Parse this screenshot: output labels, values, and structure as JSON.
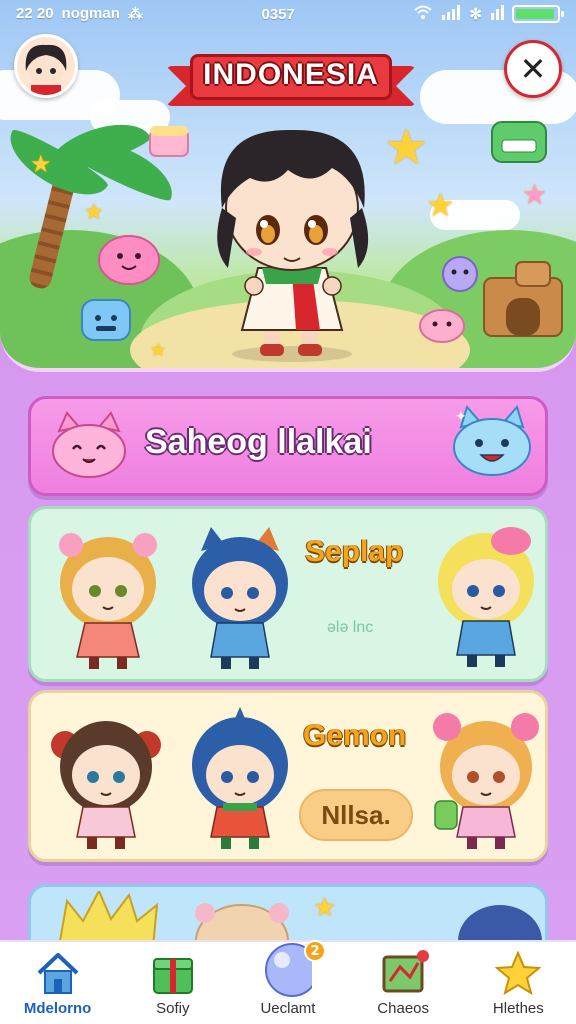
{
  "status_bar": {
    "time": "22 20",
    "carrier": "nogman",
    "center": "0357",
    "battery_fraction": 0.95
  },
  "hero": {
    "title": "INDONESIA",
    "avatar_icon": "player-avatar-icon",
    "close_label": "✕"
  },
  "cards": {
    "pink": {
      "title": "Saheog llalkai"
    },
    "mint": {
      "title": "Seplap",
      "subtitle": "ələ lnc"
    },
    "cream": {
      "title": "Gemon",
      "button_label": "Nllsa."
    }
  },
  "bottom_nav": {
    "items": [
      {
        "label": "Mdelorno",
        "icon": "home-icon",
        "active": true
      },
      {
        "label": "Sofiy",
        "icon": "gift-box-icon",
        "active": false
      },
      {
        "label": "Ueclamt",
        "icon": "orb-icon",
        "active": false,
        "badge": "2"
      },
      {
        "label": "Chaeos",
        "icon": "map-icon",
        "active": false
      },
      {
        "label": "Hlethes",
        "icon": "star-icon",
        "active": false
      }
    ]
  },
  "colors": {
    "background": "#d79af0",
    "banner_red": "#d8262f",
    "pink_card": "#f79be9",
    "mint_card": "#d9f5e4",
    "cream_card": "#fff5d9",
    "title_orange": "#f6a31d",
    "nav_active": "#1c62b8"
  }
}
